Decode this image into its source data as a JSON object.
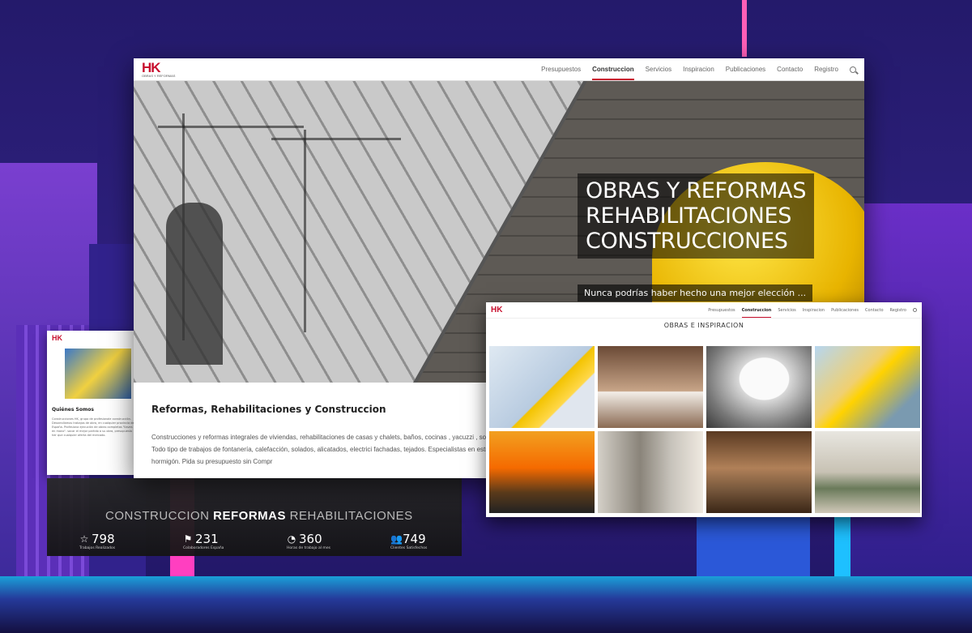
{
  "main": {
    "nav": {
      "items": [
        "Presupuestos",
        "Construccion",
        "Servicios",
        "Inspiracion",
        "Publicaciones",
        "Contacto",
        "Registro"
      ],
      "active": "Construccion"
    },
    "hero": {
      "line1": "OBRAS Y REFORMAS",
      "line2": "REHABILITACIONES",
      "line3": "CONSTRUCCIONES",
      "subtitle": "Nunca podrías haber hecho una mejor elección ..."
    },
    "content": {
      "heading": "Reformas, Rehabilitaciones y Construccion",
      "body": "Construcciones y reformas integrales de viviendas, rehabilitaciones de casas y chalets, baños, cocinas , yacuzzi , sola techos, piscinas, tejados, azoteas. Todo tipo de trabajos de fontanería, calefacción, solados, alicatados, electrici fachadas, tejados. Especialistas en estructuras metálicas y estructuras de hormigón. Pida su presupuesto sin Compr"
    }
  },
  "mini": {
    "heading": "Quiénes Somos",
    "body": "Construcciones HK, grupo de profesionale construcción. Desarrollamos trabajos de obra, en cualquier provincia de España. Profesiona ejecución de obras completas \"llaves en mano\". sacar el mejor partido a su obra, presupuesto her que cualquier oferta del mercado."
  },
  "banner": {
    "title_parts": [
      "CONSTRUCCION ",
      "REFORMAS",
      " REHABILITACIONES"
    ],
    "stats": [
      {
        "icon": "star-icon",
        "value": "798",
        "label": "Trabajos Realizados"
      },
      {
        "icon": "flag-icon",
        "value": "231",
        "label": "Colaboradores España"
      },
      {
        "icon": "gauge-icon",
        "value": "360",
        "label": "Horas de trabajo al mes"
      },
      {
        "icon": "users-icon",
        "value": "749",
        "label": "Clientes Satisfechos"
      }
    ]
  },
  "second": {
    "nav": {
      "items": [
        "Presupuestos",
        "Construccion",
        "Servicios",
        "Inspiracion",
        "Publicaciones",
        "Contacto",
        "Registro"
      ],
      "active": "Construccion"
    },
    "title": "OBRAS E INSPIRACION"
  },
  "colors": {
    "brand": "#c8102e"
  }
}
